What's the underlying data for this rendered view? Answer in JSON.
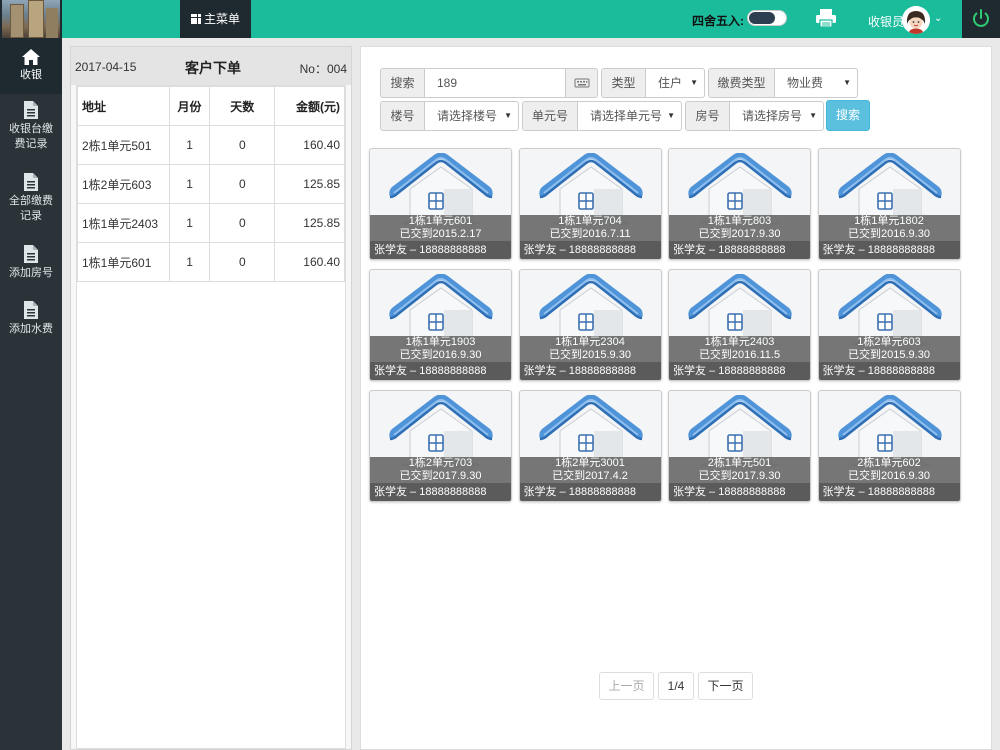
{
  "topbar": {
    "menu_label": "主菜单",
    "round_label": "四舍五入:",
    "round_toggle_on": false,
    "cashier_label": "收银员",
    "accent_color": "#1abc9c"
  },
  "sidebar": {
    "items": [
      {
        "label_line1": "收银",
        "label_line2": "",
        "icon": "home-icon",
        "active": true
      },
      {
        "label_line1": "收银台缴",
        "label_line2": "费记录",
        "icon": "document-icon",
        "active": false
      },
      {
        "label_line1": "全部缴费",
        "label_line2": "记录",
        "icon": "document-icon",
        "active": false
      },
      {
        "label_line1": "添加房号",
        "label_line2": "",
        "icon": "document-icon",
        "active": false
      },
      {
        "label_line1": "添加水费",
        "label_line2": "",
        "icon": "document-icon",
        "active": false
      }
    ]
  },
  "order": {
    "date": "2017-04-15",
    "title": "客户下单",
    "number": "No：004",
    "columns": [
      "地址",
      "月份",
      "天数",
      "金额(元)"
    ],
    "rows": [
      {
        "address": "2栋1单元501",
        "months": "1",
        "days": "0",
        "amount": "160.40"
      },
      {
        "address": "1栋2单元603",
        "months": "1",
        "days": "0",
        "amount": "125.85"
      },
      {
        "address": "1栋1单元2403",
        "months": "1",
        "days": "0",
        "amount": "125.85"
      },
      {
        "address": "1栋1单元601",
        "months": "1",
        "days": "0",
        "amount": "160.40"
      }
    ]
  },
  "filters": {
    "search_label": "搜索",
    "search_value": "189",
    "type_label": "类型",
    "type_value": "住户",
    "fee_type_label": "缴费类型",
    "fee_type_value": "物业费",
    "building_label": "楼号",
    "building_value": "请选择楼号",
    "unit_label": "单元号",
    "unit_value": "请选择单元号",
    "room_label": "房号",
    "room_value": "请选择房号",
    "search_button": "搜索"
  },
  "rooms": [
    {
      "room": "1栋1单元601",
      "paid_until": "已交到2015.2.17",
      "owner": "张学友 – 18888888888"
    },
    {
      "room": "1栋1单元704",
      "paid_until": "已交到2016.7.11",
      "owner": "张学友 – 18888888888"
    },
    {
      "room": "1栋1单元803",
      "paid_until": "已交到2017.9.30",
      "owner": "张学友 – 18888888888"
    },
    {
      "room": "1栋1单元1802",
      "paid_until": "已交到2016.9.30",
      "owner": "张学友 – 18888888888"
    },
    {
      "room": "1栋1单元1903",
      "paid_until": "已交到2016.9.30",
      "owner": "张学友 – 18888888888"
    },
    {
      "room": "1栋1单元2304",
      "paid_until": "已交到2015.9.30",
      "owner": "张学友 – 18888888888"
    },
    {
      "room": "1栋1单元2403",
      "paid_until": "已交到2016.11.5",
      "owner": "张学友 – 18888888888"
    },
    {
      "room": "1栋2单元603",
      "paid_until": "已交到2015.9.30",
      "owner": "张学友 – 18888888888"
    },
    {
      "room": "1栋2单元703",
      "paid_until": "已交到2017.9.30",
      "owner": "张学友 – 18888888888"
    },
    {
      "room": "1栋2单元3001",
      "paid_until": "已交到2017.4.2",
      "owner": "张学友 – 18888888888"
    },
    {
      "room": "2栋1单元501",
      "paid_until": "已交到2017.9.30",
      "owner": "张学友 – 18888888888"
    },
    {
      "room": "2栋1单元602",
      "paid_until": "已交到2016.9.30",
      "owner": "张学友 – 18888888888"
    }
  ],
  "pagination": {
    "prev_label": "上一页",
    "page_indicator": "1/4",
    "next_label": "下一页"
  }
}
